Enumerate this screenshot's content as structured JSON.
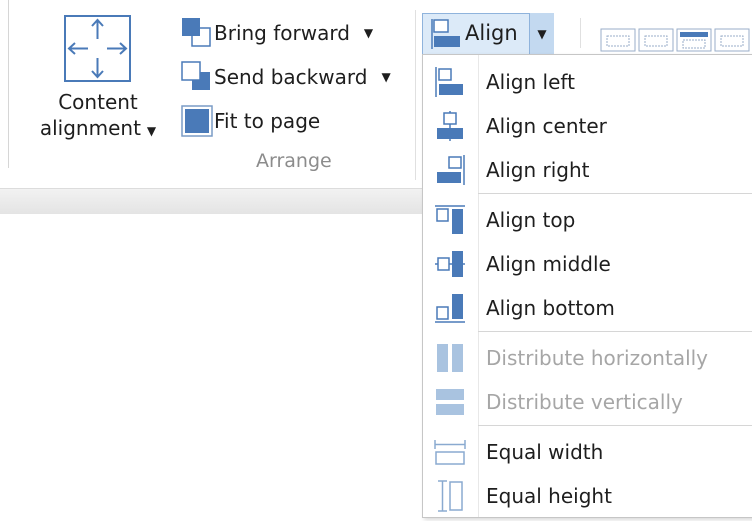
{
  "ribbon": {
    "content_alignment": {
      "line1": "Content",
      "line2": "alignment",
      "icon": "content-alignment-icon"
    },
    "bring_forward": {
      "label": "Bring forward",
      "icon": "bring-forward-icon"
    },
    "send_backward": {
      "label": "Send backward",
      "icon": "send-backward-icon"
    },
    "fit_to_page": {
      "label": "Fit to page",
      "icon": "fit-to-page-icon"
    },
    "group_label": "Arrange",
    "align": {
      "label": "Align",
      "icon": "align-icon"
    }
  },
  "align_menu": {
    "items": [
      {
        "label": "Align left",
        "icon": "align-left-icon",
        "enabled": true
      },
      {
        "label": "Align center",
        "icon": "align-center-icon",
        "enabled": true
      },
      {
        "label": "Align right",
        "icon": "align-right-icon",
        "enabled": true
      },
      {
        "label": "Align top",
        "icon": "align-top-icon",
        "enabled": true
      },
      {
        "label": "Align middle",
        "icon": "align-middle-icon",
        "enabled": true
      },
      {
        "label": "Align bottom",
        "icon": "align-bottom-icon",
        "enabled": true
      },
      {
        "label": "Distribute horizontally",
        "icon": "distribute-horizontally-icon",
        "enabled": false
      },
      {
        "label": "Distribute vertically",
        "icon": "distribute-vertically-icon",
        "enabled": false
      },
      {
        "label": "Equal width",
        "icon": "equal-width-icon",
        "enabled": true
      },
      {
        "label": "Equal height",
        "icon": "equal-height-icon",
        "enabled": true
      }
    ]
  },
  "colors": {
    "icon_blue": "#4a7ab8",
    "icon_light_blue": "#a9c3e0",
    "selected_bg": "#dceaf8",
    "selected_border": "#8fb3dc",
    "disabled_text": "#a6a6a6"
  }
}
